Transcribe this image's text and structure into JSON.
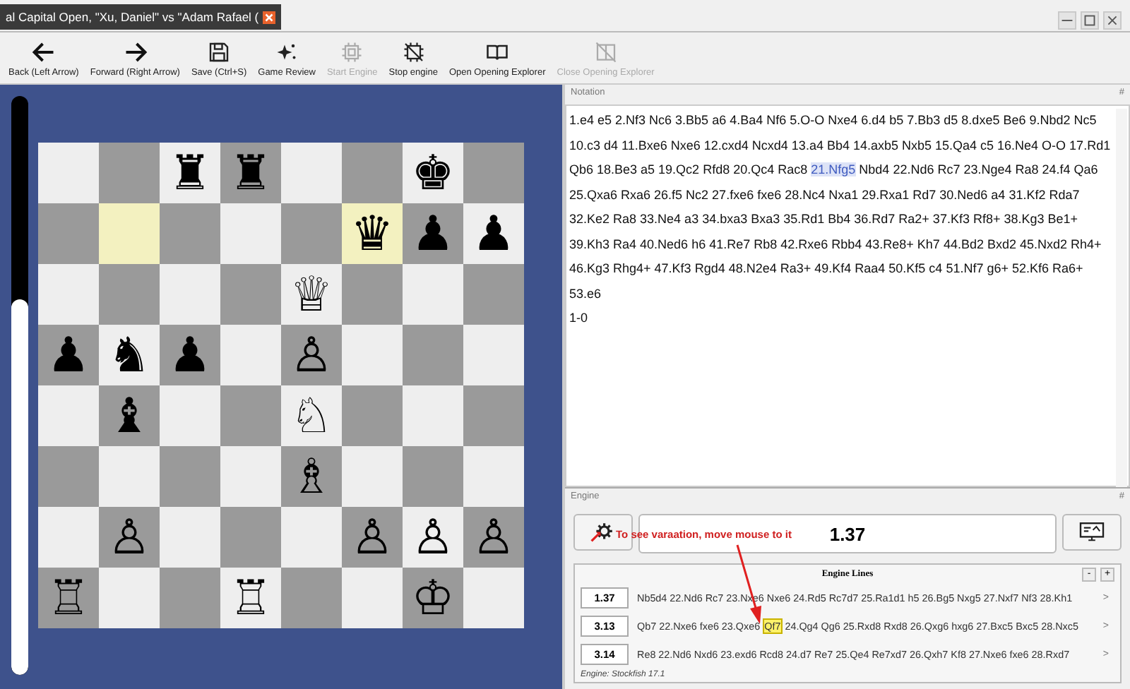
{
  "window": {
    "tab_title": "al Capital Open, \"Xu, Daniel\" vs \"Adam Rafael ("
  },
  "toolbar": [
    {
      "kind": "back",
      "label": "Back (Left Arrow)",
      "disabled": false
    },
    {
      "kind": "forward",
      "label": "Forward (Right Arrow)",
      "disabled": false
    },
    {
      "kind": "save",
      "label": "Save (Ctrl+S)",
      "disabled": false
    },
    {
      "kind": "review",
      "label": "Game Review",
      "disabled": false
    },
    {
      "kind": "start",
      "label": "Start Engine",
      "disabled": true
    },
    {
      "kind": "stop",
      "label": "Stop engine",
      "disabled": false
    },
    {
      "kind": "open",
      "label": "Open Opening Explorer",
      "disabled": false
    },
    {
      "kind": "close",
      "label": "Close Opening Explorer",
      "disabled": true
    }
  ],
  "eval_bar": {
    "level": 0.65
  },
  "board": {
    "ranks": [
      [
        {
          "highlighted": false
        },
        {
          "highlighted": false
        },
        {
          "piece": "♜",
          "highlighted": false
        },
        {
          "piece": "♜",
          "highlighted": false
        },
        {
          "highlighted": false
        },
        {
          "highlighted": false
        },
        {
          "piece": "♚",
          "highlighted": false
        },
        {
          "highlighted": false
        }
      ],
      [
        {
          "highlighted": false
        },
        {
          "highlighted": true
        },
        {
          "highlighted": false
        },
        {
          "highlighted": false
        },
        {
          "highlighted": false
        },
        {
          "piece": "♛",
          "highlighted": true
        },
        {
          "piece": "♟",
          "highlighted": false
        },
        {
          "piece": "♟",
          "highlighted": false
        }
      ],
      [
        {
          "highlighted": false
        },
        {
          "highlighted": false
        },
        {
          "highlighted": false
        },
        {
          "highlighted": false
        },
        {
          "piece": "♕",
          "highlighted": false
        },
        {
          "highlighted": false
        },
        {
          "highlighted": false
        },
        {
          "highlighted": false
        }
      ],
      [
        {
          "piece": "♟",
          "highlighted": false
        },
        {
          "piece": "♞",
          "highlighted": false
        },
        {
          "piece": "♟",
          "highlighted": false
        },
        {
          "highlighted": false
        },
        {
          "piece": "♙",
          "highlighted": false
        },
        {
          "highlighted": false
        },
        {
          "highlighted": false
        },
        {
          "highlighted": false
        }
      ],
      [
        {
          "highlighted": false
        },
        {
          "piece": "♝",
          "highlighted": false
        },
        {
          "highlighted": false
        },
        {
          "highlighted": false
        },
        {
          "piece": "♘",
          "highlighted": false
        },
        {
          "highlighted": false
        },
        {
          "highlighted": false
        },
        {
          "highlighted": false
        }
      ],
      [
        {
          "highlighted": false
        },
        {
          "highlighted": false
        },
        {
          "highlighted": false
        },
        {
          "highlighted": false
        },
        {
          "piece": "♗",
          "highlighted": false
        },
        {
          "highlighted": false
        },
        {
          "highlighted": false
        },
        {
          "highlighted": false
        }
      ],
      [
        {
          "highlighted": false
        },
        {
          "piece": "♙",
          "highlighted": false
        },
        {
          "highlighted": false
        },
        {
          "highlighted": false
        },
        {
          "highlighted": false
        },
        {
          "piece": "♙",
          "highlighted": false
        },
        {
          "piece": "♙",
          "highlighted": false
        },
        {
          "piece": "♙",
          "highlighted": false
        }
      ],
      [
        {
          "piece": "♖",
          "highlighted": false
        },
        {
          "highlighted": false
        },
        {
          "highlighted": false
        },
        {
          "piece": "♖",
          "highlighted": false
        },
        {
          "highlighted": false
        },
        {
          "highlighted": false
        },
        {
          "piece": "♔",
          "highlighted": false
        },
        {
          "highlighted": false
        }
      ]
    ]
  },
  "notation": {
    "title": "Notation",
    "pin": "#",
    "segments": [
      {
        "text": "1.e4 e5 2.Nf3 Nc6 3.Bb5 a6 4.Ba4 Nf6 5.O-O Nxe4 6.d4 b5 7.Bb3 d5 8.dxe5 Be6 9.Nbd2 Nc5 10.c3 d4 11.Bxe6 Nxe6 12.cxd4 Ncxd4 13.a4 Bb4 14.axb5 Nxb5 15.Qa4 c5 16.Ne4 O-O 17.Rd1 Qb6 18.Be3 a5 19.Qc2 Rfd8 20.Qc4 Rac8",
        "selected": false
      },
      {
        "text": "21.Nfg5",
        "selected": true
      },
      {
        "text": "Nbd4 22.Nd6 Rc7 23.Nge4 Ra8 24.f4 Qa6 25.Qxa6 Rxa6 26.f5 Nc2 27.fxe6 fxe6 28.Nc4 Nxa1 29.Rxa1 Rd7 30.Ned6 a4 31.Kf2 Rda7 32.Ke2 Ra8 33.Ne4 a3 34.bxa3 Bxa3 35.Rd1 Bb4 36.Rd7 Ra2+ 37.Kf3 Rf8+ 38.Kg3 Be1+ 39.Kh3 Ra4 40.Ned6 h6 41.Re7 Rb8 42.Rxe6 Rbb4 43.Re8+ Kh7 44.Bd2 Bxd2 45.Nxd2 Rh4+ 46.Kg3 Rhg4+ 47.Kf3 Rgd4 48.N2e4 Ra3+ 49.Kf4 Raa4 50.Kf5 c4 51.Nf7 g6+ 52.Kf6 Ra6+ 53.e6",
        "selected": false
      }
    ],
    "result": "1-0"
  },
  "engine": {
    "title": "Engine",
    "pin": "#",
    "evaluation": "1.37",
    "tooltip": "To see varaation, move mouse to it",
    "lines_title": "Engine Lines",
    "lines_buttons": [
      "-",
      "+"
    ],
    "lines": [
      {
        "score": "1.37",
        "segments": [
          {
            "text": "Nb5d4 22.Nd6 Rc7 23.Nxe6 Nxe6 24.Rd5 Rc7d7 25.Ra1d1 h5 26.Bg5 Nxg5 27.Nxf7 Nf3 28.Kh1",
            "selected": false
          }
        ],
        "expand": ">"
      },
      {
        "score": "3.13",
        "segments": [
          {
            "text": "Qb7 22.Nxe6 fxe6 23.Qxe6",
            "selected": false
          },
          {
            "text": "Qf7",
            "selected": true
          },
          {
            "text": "24.Qg4 Qg6 25.Rxd8 Rxd8 26.Qxg6 hxg6 27.Bxc5 Bxc5 28.Nxc5",
            "selected": false
          }
        ],
        "expand": ">"
      },
      {
        "score": "3.14",
        "segments": [
          {
            "text": "Re8 22.Nd6 Nxd6 23.exd6 Rcd8 24.d7 Re7 25.Qe4 Re7xd7 26.Qxh7 Kf8 27.Nxe6 fxe6 28.Rxd7",
            "selected": false
          }
        ],
        "expand": ">"
      }
    ],
    "footer": "Engine: Stockfish 17.1"
  }
}
